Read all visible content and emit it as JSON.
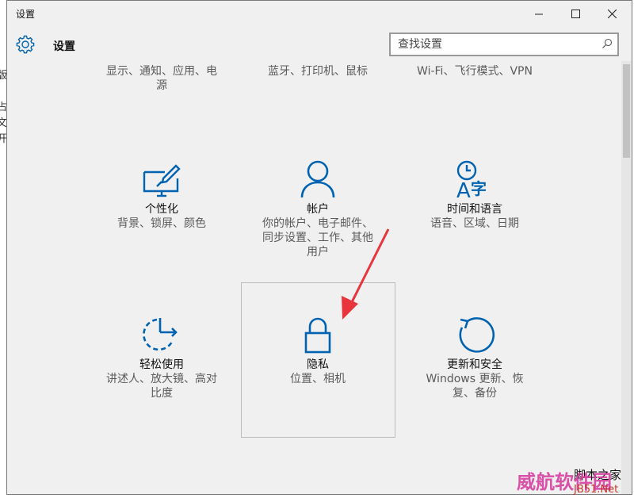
{
  "window": {
    "title": "设置"
  },
  "header": {
    "title": "设置"
  },
  "search": {
    "placeholder": "查找设置"
  },
  "top_row": [
    {
      "line1": "显示、通知、应用、电",
      "line2": "源"
    },
    {
      "line1": "蓝牙、打印机、鼠标",
      "line2": ""
    },
    {
      "line1": "Wi-Fi、飞行模式、VPN",
      "line2": ""
    }
  ],
  "tiles": {
    "personalization": {
      "title": "个性化",
      "desc": [
        "背景、锁屏、颜色"
      ]
    },
    "accounts": {
      "title": "帐户",
      "desc": [
        "你的帐户、电子邮件、",
        "同步设置、工作、其他",
        "用户"
      ]
    },
    "time_language": {
      "title": "时间和语言",
      "desc": [
        "语音、区域、日期"
      ]
    },
    "ease_of_access": {
      "title": "轻松使用",
      "desc": [
        "讲述人、放大镜、高对",
        "比度"
      ]
    },
    "privacy": {
      "title": "隐私",
      "desc": [
        "位置、相机"
      ]
    },
    "update_security": {
      "title": "更新和安全",
      "desc": [
        "Windows 更新、恢",
        "复、备份"
      ]
    }
  },
  "watermark": {
    "line1": "脚本之家",
    "line2": "威航软件园",
    "line3": "JB51.Net"
  },
  "colors": {
    "accent": "#0063b1",
    "arrow": "#e8353b",
    "watermark_pink": "#d63fa0"
  }
}
